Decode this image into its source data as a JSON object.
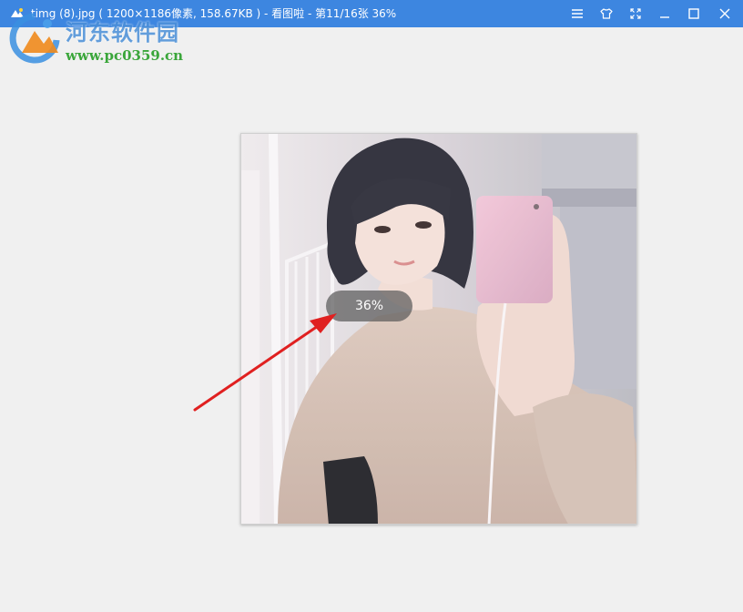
{
  "window": {
    "title": "timg (8).jpg ( 1200×1186像素, 158.67KB ) - 看图啦 - 第11/16张 36%",
    "controls": [
      "menu-icon",
      "skin-icon",
      "fullscreen-icon",
      "minimize-icon",
      "maximize-icon",
      "close-icon"
    ]
  },
  "watermark": {
    "name": "河东软件园",
    "url": "www.pc0359.cn"
  },
  "viewer": {
    "zoom_label": "36%"
  },
  "colors": {
    "titlebar": "#3d86e0",
    "background": "#f0f0f0",
    "arrow": "#e02020"
  }
}
